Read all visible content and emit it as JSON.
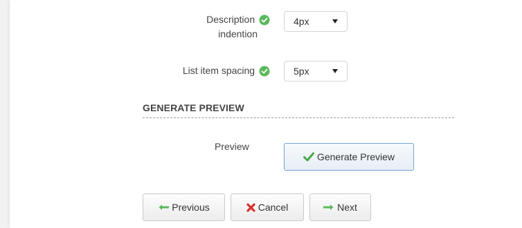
{
  "form": {
    "description_indention": {
      "label_line1": "Description",
      "label_line2": "indention",
      "value": "4px"
    },
    "list_item_spacing": {
      "label": "List item spacing",
      "value": "5px"
    }
  },
  "generate_preview": {
    "section_title": "GENERATE PREVIEW",
    "preview_label": "Preview",
    "button_label": "Generate Preview"
  },
  "navigation": {
    "previous_label": "Previous",
    "cancel_label": "Cancel",
    "next_label": "Next"
  },
  "colors": {
    "valid_check": "#5cb85c",
    "generate_border": "#6fa3d8",
    "arrow_green": "#5cb85c",
    "cancel_red": "#d9302b"
  },
  "icons": {
    "valid": "check-circle-icon",
    "generate": "checkmark-icon",
    "previous": "arrow-left-icon",
    "cancel": "x-icon",
    "next": "arrow-right-icon"
  }
}
